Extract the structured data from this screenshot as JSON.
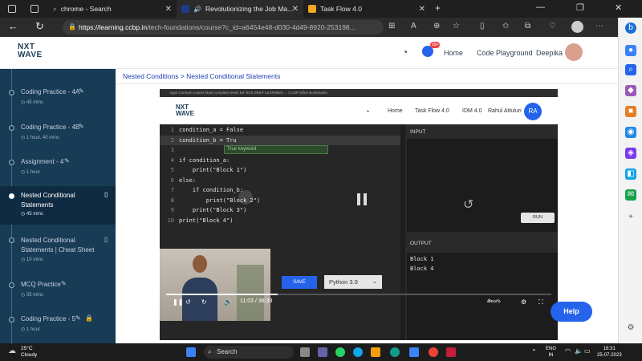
{
  "browser": {
    "tabs": [
      {
        "label": "chrome - Search"
      },
      {
        "label": "Revolutionizing the Job Ma..."
      },
      {
        "label": "Task Flow 4.0"
      }
    ],
    "new_tab": "+",
    "url_host": "https://learning.ccbp.in",
    "url_path": "/tech-foundations/course?c_id=a6454e48-d030-4d49-8920-253198..."
  },
  "header": {
    "logo_line1": "NXT",
    "logo_line2": "WAVE",
    "links": [
      "Home",
      "Code Playground",
      "Deepika"
    ],
    "notification_count": "99+"
  },
  "sidebar": {
    "items": [
      {
        "title": "Coding Practice - 4A",
        "meta": "45 mins"
      },
      {
        "title": "Coding Practice - 4B",
        "meta": "1 hour, 40 mins"
      },
      {
        "title": "Assignment - 4",
        "meta": "1 hour"
      },
      {
        "title": "Nested Conditional Statements",
        "meta": "45 mins"
      },
      {
        "title": "Nested Conditional Statements | Cheat Sheet",
        "meta": "10 mins"
      },
      {
        "title": "MCQ Practice",
        "meta": "35 mins"
      },
      {
        "title": "Coding Practice - 5",
        "meta": "1 hour"
      }
    ]
  },
  "breadcrumb": "Nested Conditions > Nested Conditional Statements",
  "video": {
    "bookmarks": "Apps   Curated content   Must complete   News   Ed-Tech   DEEP LEARNING ...   CCBP                                                                     Other Bookmarks",
    "inner_links": [
      "Home",
      "Task Flow 4.0",
      "IDM 4.0",
      "Rahul Attuluri"
    ],
    "inner_avatar": "RA",
    "code": [
      {
        "n": "1",
        "text": "condition_a = False"
      },
      {
        "n": "2",
        "text": "condition_b = Tru"
      },
      {
        "n": "3",
        "text": ""
      },
      {
        "n": "4",
        "text": "if condition_a:"
      },
      {
        "n": "5",
        "text": "    print(\"Block 1\")"
      },
      {
        "n": "6",
        "text": "else:"
      },
      {
        "n": "7",
        "text": "    if condition_b:"
      },
      {
        "n": "8",
        "text": "        print(\"Block 2\")"
      },
      {
        "n": "9",
        "text": "    print(\"Block 3\")"
      },
      {
        "n": "10",
        "text": "print(\"Block 4\")"
      }
    ],
    "autocomplete": "True  keyword",
    "input_label": "INPUT",
    "run_label": "RUN",
    "output_label": "OUTPUT",
    "output_lines": [
      "Block 1",
      "Block 4"
    ],
    "save_label": "SAVE",
    "language": "Python 3.9",
    "time": "11:03 / 38:33",
    "progress": 0.29,
    "quality_label": "తెలుగు"
  },
  "help_label": "Help",
  "taskbar": {
    "weather_temp": "25°C",
    "weather_desc": "Cloudy",
    "search_label": "Search",
    "lang": "ENG",
    "lang2": "IN",
    "time": "16:31",
    "date": "25-07-2023"
  },
  "colors": {
    "brand_blue": "#2563eb",
    "sidebar_bg": "#183b56"
  }
}
